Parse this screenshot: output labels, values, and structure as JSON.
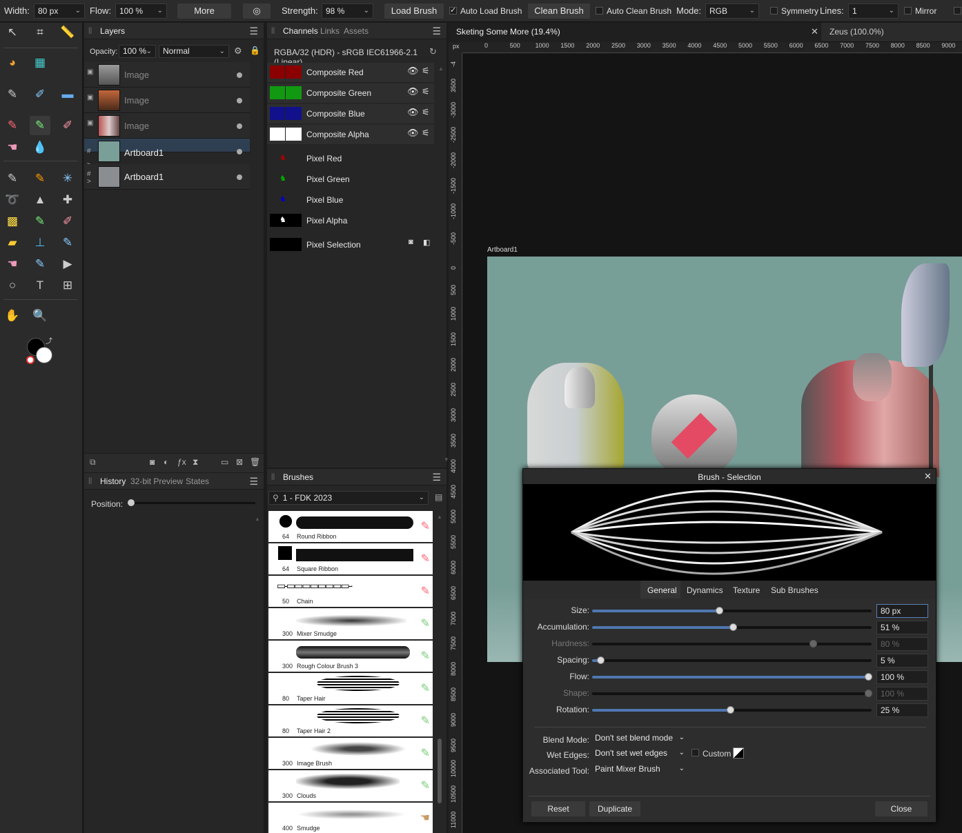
{
  "toolbar": {
    "width_label": "Width:",
    "width_value": "80 px",
    "flow_label": "Flow:",
    "flow_value": "100 %",
    "more_label": "More",
    "strength_label": "Strength:",
    "strength_value": "98 %",
    "load_brush_label": "Load Brush",
    "auto_load_label": "Auto Load Brush",
    "clean_brush_label": "Clean Brush",
    "auto_clean_label": "Auto Clean Brush",
    "mode_label": "Mode:",
    "mode_value": "RGB",
    "symmetry_label": "Symmetry",
    "lines_label": "Lines:",
    "lines_value": "1",
    "mirror_label": "Mirror"
  },
  "layers_panel": {
    "tab": "Layers",
    "opacity_label": "Opacity:",
    "opacity_value": "100 %",
    "blend_value": "Normal",
    "layers": [
      {
        "name": "Image"
      },
      {
        "name": "Image"
      },
      {
        "name": "Image"
      },
      {
        "name": "Artboard1"
      },
      {
        "name": "Artboard1"
      }
    ]
  },
  "history_panel": {
    "tabs": [
      "History",
      "32-bit Preview",
      "States"
    ],
    "position_label": "Position:"
  },
  "channels_panel": {
    "tabs": [
      "Channels",
      "Links",
      "Assets"
    ],
    "profile": "RGBA/32 (HDR) - sRGB IEC61966-2.1 (Linear)",
    "channels": [
      {
        "name": "Composite Red",
        "color": "#8b0000"
      },
      {
        "name": "Composite Green",
        "color": "#119911"
      },
      {
        "name": "Composite Blue",
        "color": "#11118b"
      },
      {
        "name": "Composite Alpha",
        "color": "#ffffff"
      },
      {
        "name": "Pixel Red",
        "color": "#aa0000"
      },
      {
        "name": "Pixel Green",
        "color": "#00aa00"
      },
      {
        "name": "Pixel Blue",
        "color": "#0000cc"
      },
      {
        "name": "Pixel Alpha",
        "color": "#000000"
      },
      {
        "name": "Pixel Selection",
        "color": "#000000"
      }
    ]
  },
  "brushes_panel": {
    "tab": "Brushes",
    "category": "1 - FDK 2023",
    "brushes": [
      {
        "size": "64",
        "name": "Round Ribbon"
      },
      {
        "size": "64",
        "name": "Square Ribbon"
      },
      {
        "size": "50",
        "name": "Chain"
      },
      {
        "size": "300",
        "name": "Mixer Smudge"
      },
      {
        "size": "300",
        "name": "Rough Colour Brush 3"
      },
      {
        "size": "80",
        "name": "Taper Hair"
      },
      {
        "size": "80",
        "name": "Taper Hair 2"
      },
      {
        "size": "300",
        "name": "Image Brush"
      },
      {
        "size": "300",
        "name": "Clouds"
      },
      {
        "size": "400",
        "name": "Smudge"
      }
    ]
  },
  "document_tabs": [
    {
      "title": "Sketing Some More (19.4%)"
    },
    {
      "title": "Zeus (100.0%)"
    }
  ],
  "ruler": {
    "unit": "px",
    "top_ticks": [
      "0",
      "500",
      "1000",
      "1500",
      "2000",
      "2500",
      "3000",
      "3500",
      "4000",
      "4500",
      "5000",
      "5500",
      "6000",
      "6500",
      "7000",
      "7500",
      "8000",
      "8500",
      "9000"
    ],
    "left_ticks": [
      "-4",
      "3500",
      "-3000",
      "-2500",
      "-2000",
      "-1500",
      "-1000",
      "-500",
      "0",
      "500",
      "1000",
      "1500",
      "2000",
      "2500",
      "3000",
      "3500",
      "4000",
      "4500",
      "5000",
      "5500",
      "6000",
      "6500",
      "7000",
      "7500",
      "8000",
      "8500",
      "9000",
      "9500",
      "10000",
      "10500",
      "11000"
    ]
  },
  "canvas": {
    "artboard_label": "Artboard1",
    "background_color": "#789e98"
  },
  "dialog": {
    "title": "Brush - Selection",
    "tabs": [
      "General",
      "Dynamics",
      "Texture",
      "Sub Brushes"
    ],
    "rows": [
      {
        "label": "Size:",
        "value": "80 px",
        "pos": 0.46,
        "enabled": true
      },
      {
        "label": "Accumulation:",
        "value": "51 %",
        "pos": 0.51,
        "enabled": true
      },
      {
        "label": "Hardness:",
        "value": "80 %",
        "pos": 0.8,
        "enabled": false
      },
      {
        "label": "Spacing:",
        "value": "5 %",
        "pos": 0.03,
        "enabled": true
      },
      {
        "label": "Flow:",
        "value": "100 %",
        "pos": 1.0,
        "enabled": true
      },
      {
        "label": "Shape:",
        "value": "100 %",
        "pos": 1.0,
        "enabled": false
      },
      {
        "label": "Rotation:",
        "value": "25 %",
        "pos": 0.5,
        "enabled": true
      }
    ],
    "blend_mode_label": "Blend Mode:",
    "blend_mode_value": "Don't set blend mode",
    "wet_edges_label": "Wet Edges:",
    "wet_edges_value": "Don't set wet edges",
    "custom_label": "Custom",
    "assoc_tool_label": "Associated Tool:",
    "assoc_tool_value": "Paint Mixer Brush",
    "reset_label": "Reset",
    "duplicate_label": "Duplicate",
    "close_label": "Close"
  }
}
